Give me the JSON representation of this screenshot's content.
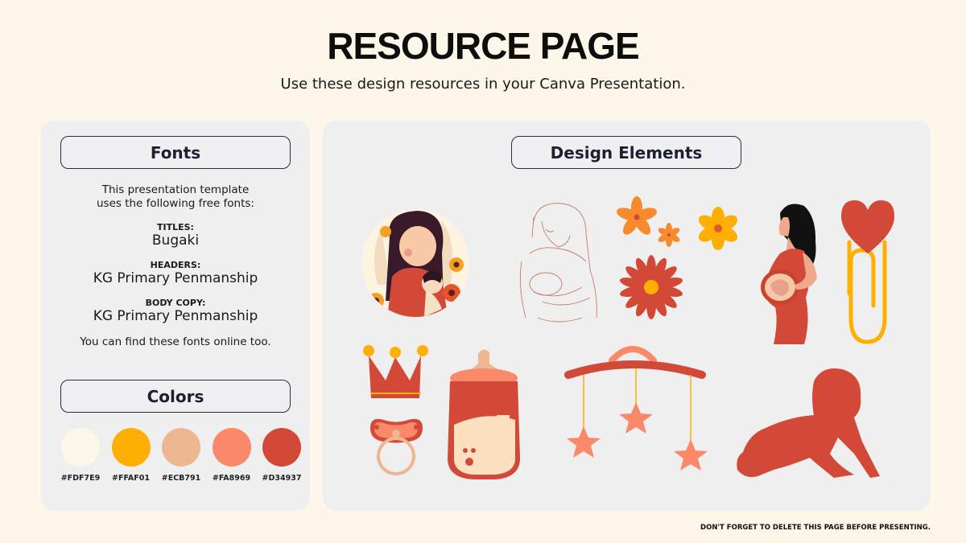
{
  "header": {
    "title": "RESOURCE PAGE",
    "subtitle": "Use these design resources in your Canva Presentation."
  },
  "fonts_panel": {
    "heading": "Fonts",
    "intro_line1": "This presentation template",
    "intro_line2": "uses the following free fonts:",
    "fonts": [
      {
        "label": "TITLES:",
        "name": "Bugaki"
      },
      {
        "label": "HEADERS:",
        "name": "KG Primary Penmanship"
      },
      {
        "label": "BODY COPY:",
        "name": "KG Primary Penmanship"
      }
    ],
    "outro": "You can find these fonts online too."
  },
  "colors_panel": {
    "heading": "Colors",
    "swatches": [
      {
        "hex": "#FDF7E9",
        "label": "#FDF7E9"
      },
      {
        "hex": "#FFAF01",
        "label": "#FFAF01"
      },
      {
        "hex": "#ECB791",
        "label": "#ECB791"
      },
      {
        "hex": "#FA8969",
        "label": "#FA8969"
      },
      {
        "hex": "#D34937",
        "label": "#D34937"
      }
    ]
  },
  "design_panel": {
    "heading": "Design Elements",
    "elements": [
      "mother-and-baby-illustration",
      "breastfeeding-line-art",
      "orange-flowers",
      "yellow-flower",
      "red-daisy",
      "pregnant-woman",
      "heart-paperclip",
      "crown",
      "pacifier",
      "baby-bottle",
      "baby-mobile",
      "crawling-baby-silhouette"
    ]
  },
  "footer": {
    "note": "DON'T FORGET TO DELETE THIS PAGE BEFORE PRESENTING."
  }
}
